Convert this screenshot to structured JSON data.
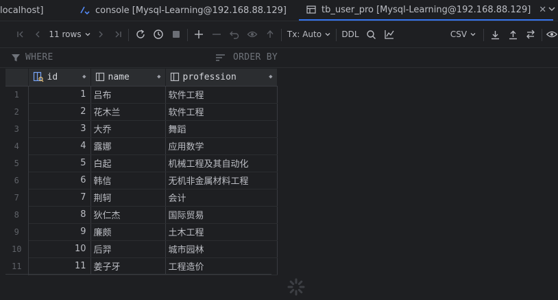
{
  "tabs": [
    {
      "label": "localhost]"
    },
    {
      "label": "console [Mysql-Learning@192.168.88.129]"
    },
    {
      "label": "tb_user_pro [Mysql-Learning@192.168.88.129]"
    }
  ],
  "toolbar": {
    "rows_label": "11 rows",
    "tx_label": "Tx: Auto",
    "ddl_label": "DDL",
    "export_format": "CSV"
  },
  "filters": {
    "where_label": "WHERE",
    "order_by_label": "ORDER BY"
  },
  "table": {
    "columns": [
      "id",
      "name",
      "profession"
    ],
    "rows": [
      {
        "n": "1",
        "id": "1",
        "name": "吕布",
        "profession": "软件工程"
      },
      {
        "n": "2",
        "id": "2",
        "name": "花木兰",
        "profession": "软件工程"
      },
      {
        "n": "3",
        "id": "3",
        "name": "大乔",
        "profession": "舞蹈"
      },
      {
        "n": "4",
        "id": "4",
        "name": "露娜",
        "profession": "应用数学"
      },
      {
        "n": "5",
        "id": "5",
        "name": "白起",
        "profession": "机械工程及其自动化"
      },
      {
        "n": "6",
        "id": "6",
        "name": "韩信",
        "profession": "无机非金属材料工程"
      },
      {
        "n": "7",
        "id": "7",
        "name": "荆轲",
        "profession": "会计"
      },
      {
        "n": "8",
        "id": "8",
        "name": "狄仁杰",
        "profession": "国际贸易"
      },
      {
        "n": "9",
        "id": "9",
        "name": "廉颇",
        "profession": "土木工程"
      },
      {
        "n": "10",
        "id": "10",
        "name": "后羿",
        "profession": "城市园林"
      },
      {
        "n": "11",
        "id": "11",
        "name": "姜子牙",
        "profession": "工程造价"
      }
    ]
  },
  "colors": {
    "background": "#1e1f22",
    "accent": "#3574f0",
    "header_bg": "#2b2d30"
  }
}
